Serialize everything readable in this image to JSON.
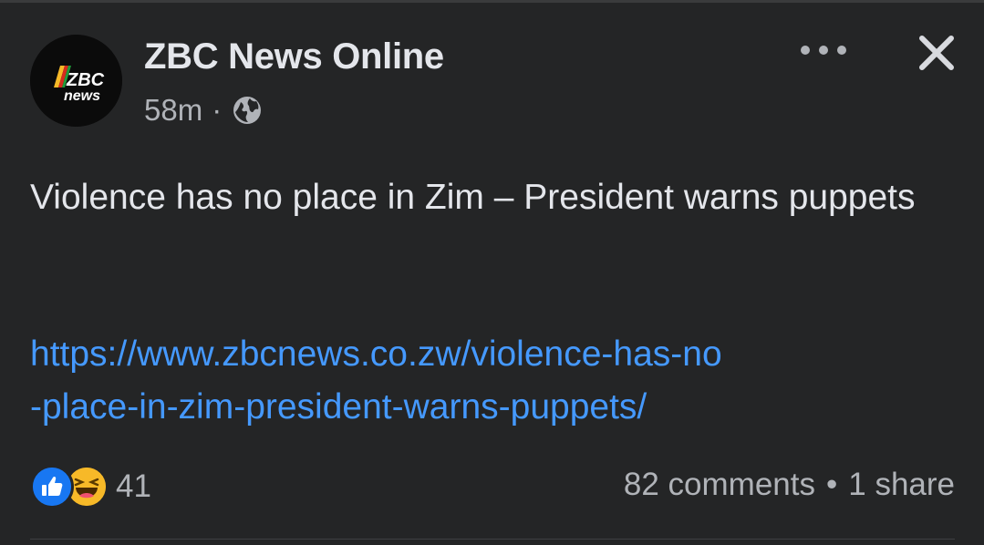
{
  "post": {
    "author": "ZBC News Online",
    "avatar_logo_text": "ZBC news",
    "time": "58m",
    "meta_separator": "·",
    "privacy_icon": "globe-icon",
    "message": "Violence has no place in Zim – President warns puppets",
    "link_line1": "https://www.zbcnews.co.zw/violence-has-no",
    "link_line2": "-place-in-zim-president-warns-puppets/",
    "more_icon": "more-options-icon",
    "close_icon": "close-icon"
  },
  "footer": {
    "reactions": [
      "like-icon",
      "haha-icon"
    ],
    "reaction_count": "41",
    "comments": "82 comments",
    "separator": "•",
    "shares": "1 share"
  },
  "colors": {
    "background": "#242526",
    "text_primary": "#e4e6eb",
    "text_secondary": "#b0b3b8",
    "link": "#4599ff",
    "like_blue": "#1877f2",
    "haha_yellow": "#f7b928"
  }
}
